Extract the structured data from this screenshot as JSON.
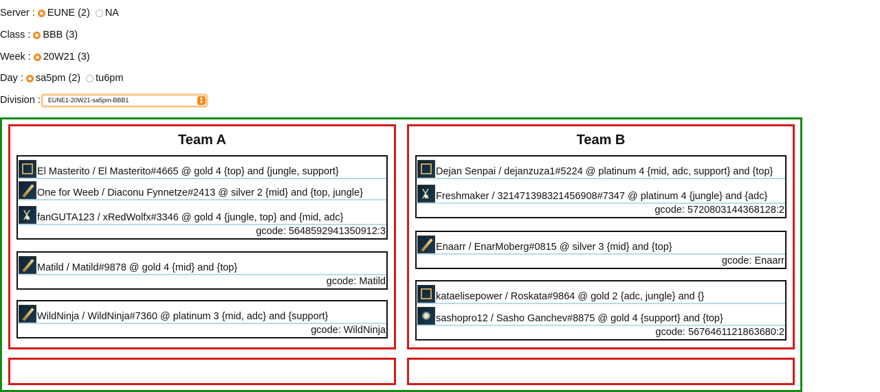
{
  "filters": {
    "server": {
      "label": "Server :",
      "options": [
        {
          "text": "EUNE (2)",
          "selected": true
        },
        {
          "text": "NA",
          "selected": false
        }
      ]
    },
    "class": {
      "label": "Class :",
      "options": [
        {
          "text": "BBB (3)",
          "selected": true
        }
      ]
    },
    "week": {
      "label": "Week :",
      "options": [
        {
          "text": "20W21 (3)",
          "selected": true
        }
      ]
    },
    "day": {
      "label": "Day :",
      "options": [
        {
          "text": "sa5pm (2)",
          "selected": true
        },
        {
          "text": "tu6pm",
          "selected": false
        }
      ]
    },
    "division": {
      "label": "Division :",
      "value": "EUNE1-20W21-sa5pm-BBB1"
    }
  },
  "teams": [
    {
      "title": "Team A",
      "groups": [
        {
          "players": [
            {
              "icon": "frame-icon",
              "text": "El Masterito / El Masterito#4665 @ gold 4 {top} and {jungle, support}"
            },
            {
              "icon": "sword-icon",
              "text": "One for Weeb / Diaconu Fynnetze#2413 @ silver 2 {mid} and {top, jungle}"
            },
            {
              "icon": "claw-icon",
              "text": "fanGUTA123 / xRedWolfx#3346 @ gold 4 {jungle, top} and {mid, adc}"
            }
          ],
          "gcode": "gcode: 5648592941350912:3"
        },
        {
          "players": [
            {
              "icon": "sword-icon",
              "text": "Matild / Matild#9878 @ gold 4 {mid} and {top}"
            }
          ],
          "gcode": "gcode: Matild"
        },
        {
          "players": [
            {
              "icon": "sword-icon",
              "text": "WildNinja / WildNinja#7360 @ platinum 3 {mid, adc} and {support}"
            }
          ],
          "gcode": "gcode: WildNinja"
        }
      ]
    },
    {
      "title": "Team B",
      "groups": [
        {
          "players": [
            {
              "icon": "frame-icon",
              "text": "Dejan Senpai / dejanzuza1#5224 @ platinum 4 {mid, adc, support} and {top}"
            },
            {
              "icon": "claw-icon",
              "text": "Freshmaker / 321471398321456908#7347 @ platinum 4 {jungle} and {adc}"
            }
          ],
          "gcode": "gcode: 5720803144368128:2"
        },
        {
          "players": [
            {
              "icon": "sword-icon",
              "text": "Enaarr / EnarMoberg#0815 @ silver 3 {mid} and {top}"
            }
          ],
          "gcode": "gcode: Enaarr"
        },
        {
          "players": [
            {
              "icon": "frame-icon",
              "text": "kataelisepower / Roskata#9864 @ gold 2 {adc, jungle} and {}"
            },
            {
              "icon": "star-icon",
              "text": "sashopro12 / Sasho Ganchev#8875 @ gold 4 {support} and {top}"
            }
          ],
          "gcode": "gcode: 5676461121863680:2"
        }
      ]
    }
  ]
}
